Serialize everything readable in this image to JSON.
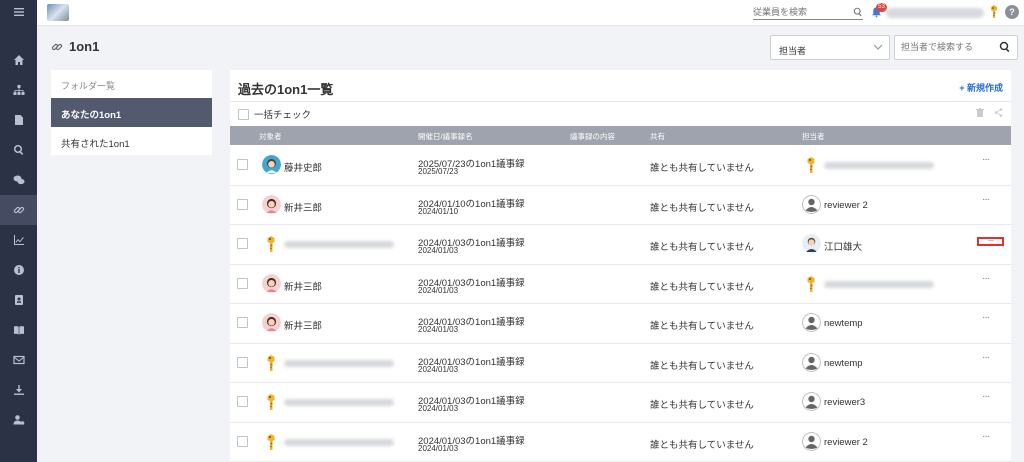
{
  "sidebar": {
    "items": [
      {
        "icon": "menu-icon"
      },
      {
        "icon": "home-icon"
      },
      {
        "icon": "org-chart-icon"
      },
      {
        "icon": "document-icon"
      },
      {
        "icon": "search-icon"
      },
      {
        "icon": "chat-icon"
      },
      {
        "icon": "link-icon",
        "active": true
      },
      {
        "icon": "chart-icon"
      },
      {
        "icon": "info-icon"
      },
      {
        "icon": "contact-card-icon"
      },
      {
        "icon": "book-icon"
      },
      {
        "icon": "mail-icon"
      },
      {
        "icon": "download-icon"
      },
      {
        "icon": "user-settings-icon"
      }
    ]
  },
  "topbar": {
    "search_placeholder": "従業員を検索",
    "notification_count": "53",
    "help_label": "?"
  },
  "page": {
    "title": "1on1",
    "filter_select": "担当者",
    "search_placeholder": "担当者で検索する"
  },
  "folders": {
    "header": "フォルダ一覧",
    "items": [
      "あなたの1on1",
      "共有された1on1"
    ]
  },
  "main": {
    "title": "過去の1on1一覧",
    "new_button": "+ 新規作成",
    "bulk_check": "一括チェック",
    "columns": [
      "対象者",
      "開催日/議事録名",
      "議事録の内容",
      "共有",
      "担当者"
    ],
    "rows": [
      {
        "target": "藤井史郎",
        "target_avatar": "female-avatar-blue",
        "title": "2025/07/23の1on1議事録",
        "date": "2025/07/23",
        "share": "誰とも共有していません",
        "reviewer": "",
        "reviewer_avatar": "giraffe-avatar",
        "highlight": false
      },
      {
        "target": "新井三郎",
        "target_avatar": "female-avatar-pink",
        "title": "2024/01/10の1on1議事録",
        "date": "2024/01/10",
        "share": "誰とも共有していません",
        "reviewer": "reviewer 2",
        "reviewer_avatar": "default-user-avatar",
        "highlight": false
      },
      {
        "target": "",
        "target_avatar": "giraffe-avatar",
        "title": "2024/01/03の1on1議事録",
        "date": "2024/01/03",
        "share": "誰とも共有していません",
        "reviewer": "江口雄大",
        "reviewer_avatar": "male-avatar",
        "highlight": true
      },
      {
        "target": "新井三郎",
        "target_avatar": "female-avatar-pink",
        "title": "2024/01/03の1on1議事録",
        "date": "2024/01/03",
        "share": "誰とも共有していません",
        "reviewer": "",
        "reviewer_avatar": "giraffe-avatar",
        "highlight": false
      },
      {
        "target": "新井三郎",
        "target_avatar": "female-avatar-pink",
        "title": "2024/01/03の1on1議事録",
        "date": "2024/01/03",
        "share": "誰とも共有していません",
        "reviewer": "newtemp",
        "reviewer_avatar": "default-user-avatar",
        "highlight": false
      },
      {
        "target": "",
        "target_avatar": "giraffe-avatar",
        "title": "2024/01/03の1on1議事録",
        "date": "2024/01/03",
        "share": "誰とも共有していません",
        "reviewer": "newtemp",
        "reviewer_avatar": "default-user-avatar",
        "highlight": false
      },
      {
        "target": "",
        "target_avatar": "giraffe-avatar",
        "title": "2024/01/03の1on1議事録",
        "date": "2024/01/03",
        "share": "誰とも共有していません",
        "reviewer": "reviewer3",
        "reviewer_avatar": "default-user-avatar",
        "highlight": false
      },
      {
        "target": "",
        "target_avatar": "giraffe-avatar",
        "title": "2024/01/03の1on1議事録",
        "date": "2024/01/03",
        "share": "誰とも共有していません",
        "reviewer": "reviewer 2",
        "reviewer_avatar": "default-user-avatar",
        "highlight": false
      }
    ],
    "more_label": "···"
  }
}
